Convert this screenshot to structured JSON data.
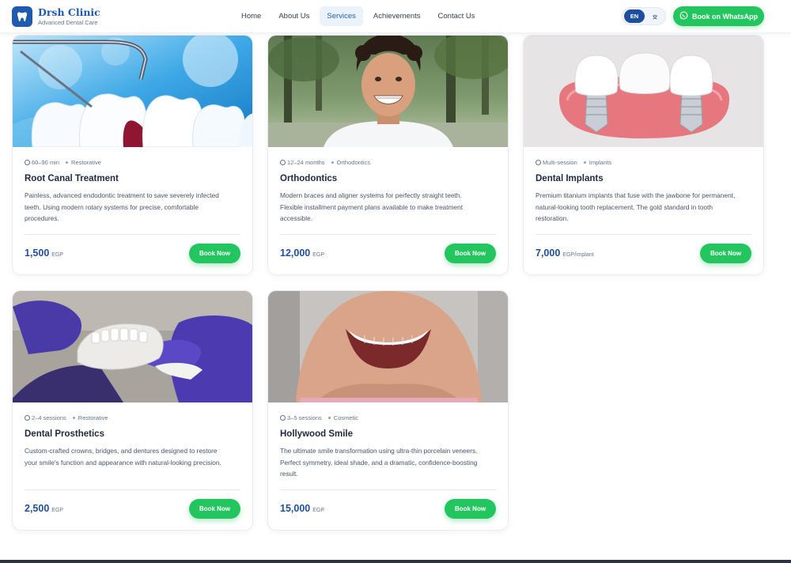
{
  "header": {
    "brand_name": "Drsh Clinic",
    "brand_tagline": "Advanced Dental Care",
    "logo_icon": "tooth-icon",
    "nav": [
      {
        "label": "Home",
        "active": false
      },
      {
        "label": "About Us",
        "active": false
      },
      {
        "label": "Services",
        "active": true
      },
      {
        "label": "Achievements",
        "active": false
      },
      {
        "label": "Contact Us",
        "active": false
      }
    ],
    "language": {
      "current": "EN",
      "alt_icon": "translate-icon"
    },
    "whatsapp_button": "Book on WhatsApp",
    "whatsapp_icon": "whatsapp-icon"
  },
  "colors": {
    "brand_blue": "#1e5bb0",
    "price_blue": "#1e4f9e",
    "accent_green": "#22c55e",
    "nav_active_bg": "#eaf2fc"
  },
  "services": [
    {
      "duration": "60–90 min",
      "category": "Restorative",
      "title": "Root Canal Treatment",
      "description": "Painless, advanced endodontic treatment to save severely infected teeth. Using modern rotary systems for precise, comfortable procedures.",
      "price": "1,500",
      "unit": "EGP",
      "button": "Book Now"
    },
    {
      "duration": "12–24 months",
      "category": "Orthodontics",
      "title": "Orthodontics",
      "description": "Modern braces and aligner systems for perfectly straight teeth. Flexible installment payment plans available to make treatment accessible.",
      "price": "12,000",
      "unit": "EGP",
      "button": "Book Now"
    },
    {
      "duration": "Multi-session",
      "category": "Implants",
      "title": "Dental Implants",
      "description": "Premium titanium implants that fuse with the jawbone for permanent, natural-looking tooth replacement. The gold standard in tooth restoration.",
      "price": "7,000",
      "unit": "EGP/implant",
      "button": "Book Now"
    },
    {
      "duration": "2–4 sessions",
      "category": "Restorative",
      "title": "Dental Prosthetics",
      "description": "Custom-crafted crowns, bridges, and dentures designed to restore your smile's function and appearance with natural-looking precision.",
      "price": "2,500",
      "unit": "EGP",
      "button": "Book Now"
    },
    {
      "duration": "3–5 sessions",
      "category": "Cosmetic",
      "title": "Hollywood Smile",
      "description": "The ultimate smile transformation using ultra-thin porcelain veneers. Perfect symmetry, ideal shade, and a dramatic, confidence-boosting result.",
      "price": "15,000",
      "unit": "EGP",
      "button": "Book Now"
    }
  ]
}
